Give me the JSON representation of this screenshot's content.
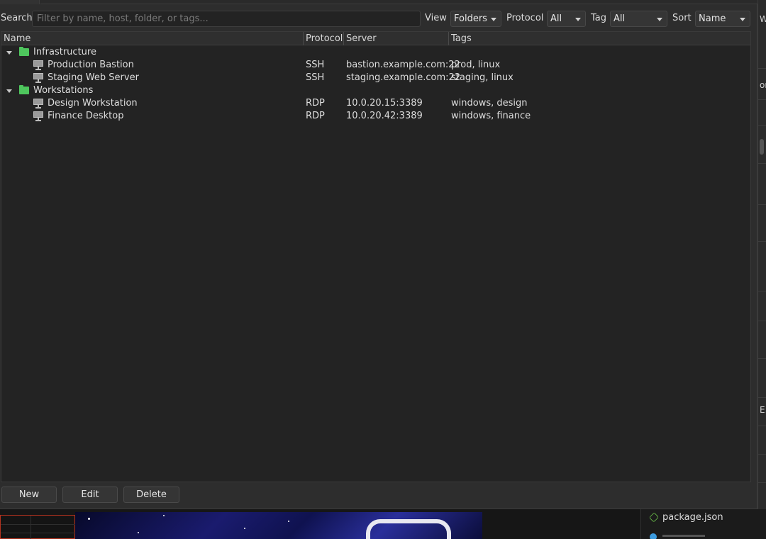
{
  "search": {
    "label": "Search",
    "placeholder": "Filter by name, host, folder, or tags..."
  },
  "filters": {
    "view": {
      "label": "View",
      "value": "Folders"
    },
    "protocol": {
      "label": "Protocol",
      "value": "All"
    },
    "tag": {
      "label": "Tag",
      "value": "All"
    },
    "sort": {
      "label": "Sort",
      "value": "Name"
    }
  },
  "columns": {
    "name": "Name",
    "protocol": "Protocol",
    "server": "Server",
    "tags": "Tags"
  },
  "tree": [
    {
      "folder": "Infrastructure",
      "icon": "folder-icon",
      "color": "#4ec65d",
      "items": [
        {
          "name": "Production Bastion",
          "protocol": "SSH",
          "server": "bastion.example.com:22",
          "tags": "prod, linux",
          "icon": "monitor-icon"
        },
        {
          "name": "Staging Web Server",
          "protocol": "SSH",
          "server": "staging.example.com:22",
          "tags": "staging, linux",
          "icon": "monitor-icon"
        }
      ]
    },
    {
      "folder": "Workstations",
      "icon": "folder-icon",
      "color": "#4ec65d",
      "items": [
        {
          "name": "Design Workstation",
          "protocol": "RDP",
          "server": "10.0.20.15:3389",
          "tags": "windows, design",
          "icon": "monitor-icon"
        },
        {
          "name": "Finance Desktop",
          "protocol": "RDP",
          "server": "10.0.20.42:3389",
          "tags": "windows, finance",
          "icon": "monitor-icon"
        }
      ]
    }
  ],
  "buttons": {
    "new": "New",
    "edit": "Edit",
    "delete": "Delete"
  },
  "background": {
    "right_fragments": [
      "W",
      "on",
      "E."
    ],
    "file_item": "package.json",
    "file_icon": "nodejs-icon"
  }
}
